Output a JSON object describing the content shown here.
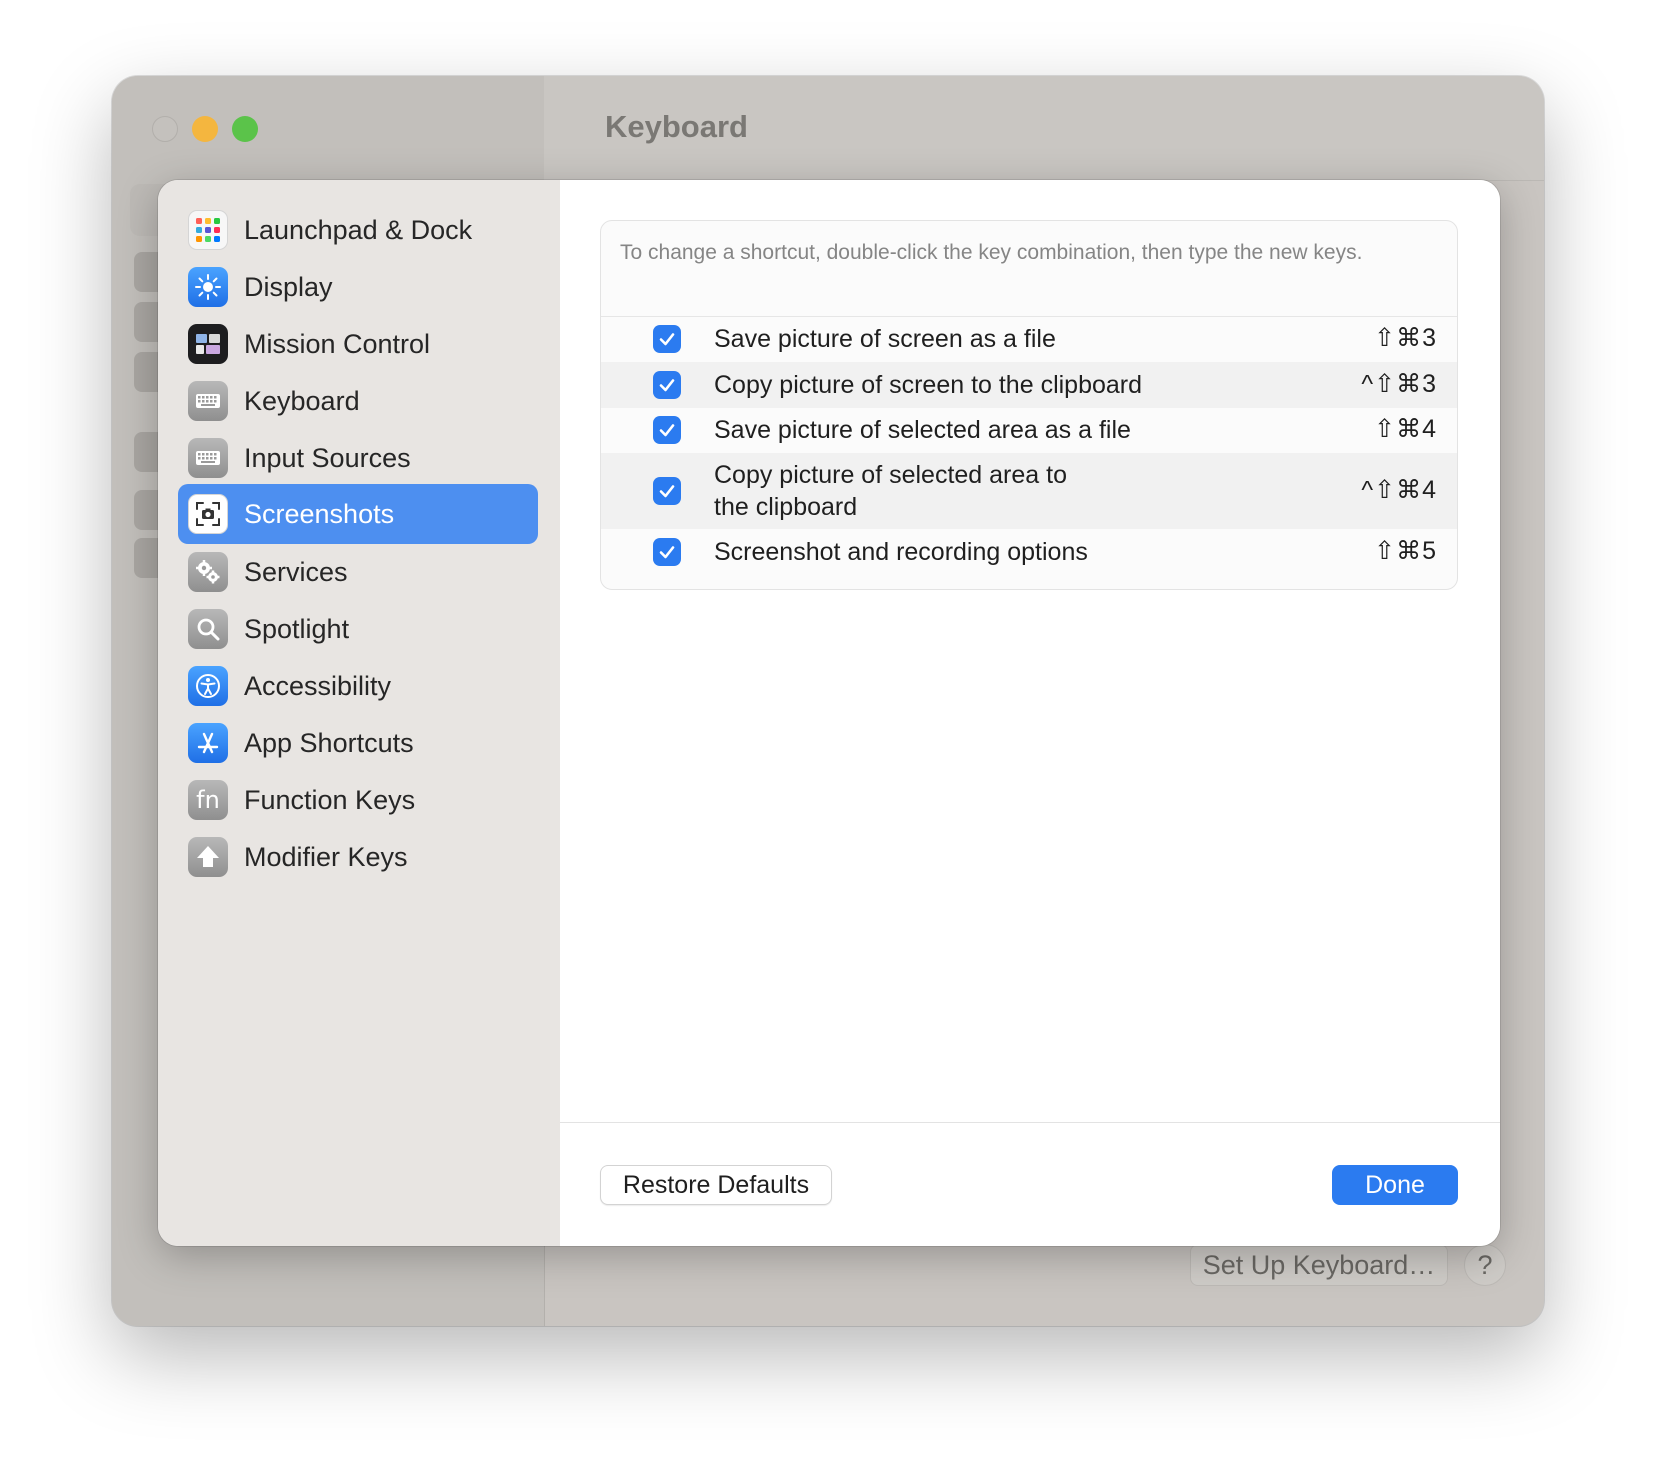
{
  "background_window": {
    "title": "Keyboard",
    "setup_button_label": "Set Up Keyboard…",
    "help_button_label": "?"
  },
  "sidebar": {
    "items": [
      {
        "label": "Launchpad & Dock",
        "icon": "launchpad-icon"
      },
      {
        "label": "Display",
        "icon": "display-icon"
      },
      {
        "label": "Mission Control",
        "icon": "mission-control-icon"
      },
      {
        "label": "Keyboard",
        "icon": "keyboard-icon"
      },
      {
        "label": "Input Sources",
        "icon": "input-sources-icon"
      },
      {
        "label": "Screenshots",
        "icon": "screenshots-icon",
        "selected": true
      },
      {
        "label": "Services",
        "icon": "services-gears-icon"
      },
      {
        "label": "Spotlight",
        "icon": "spotlight-magnifier-icon"
      },
      {
        "label": "Accessibility",
        "icon": "accessibility-icon"
      },
      {
        "label": "App Shortcuts",
        "icon": "app-store-icon"
      },
      {
        "label": "Function Keys",
        "icon": "fn-key-icon",
        "glyph": "fn"
      },
      {
        "label": "Modifier Keys",
        "icon": "shift-arrow-icon"
      }
    ]
  },
  "shortcuts": {
    "hint": "To change a shortcut, double-click the key combination, then type the new keys.",
    "rows": [
      {
        "label": "Save picture of screen as a file",
        "keys": "⇧⌘3",
        "checked": true
      },
      {
        "label": "Copy picture of screen to the clipboard",
        "keys": "^⇧⌘3",
        "checked": true
      },
      {
        "label": "Save picture of selected area as a file",
        "keys": "⇧⌘4",
        "checked": true
      },
      {
        "label": "Copy picture of selected area to",
        "label_line2": "the clipboard",
        "keys": "^⇧⌘4",
        "checked": true
      },
      {
        "label": "Screenshot and recording options",
        "keys": "⇧⌘5",
        "checked": true
      }
    ]
  },
  "footer": {
    "restore_label": "Restore Defaults",
    "done_label": "Done"
  },
  "colors": {
    "accent": "#2b7bf0",
    "sidebar_selected": "#4d8ff0",
    "traffic_min": "#f4b63f",
    "traffic_max": "#5bc34a"
  }
}
